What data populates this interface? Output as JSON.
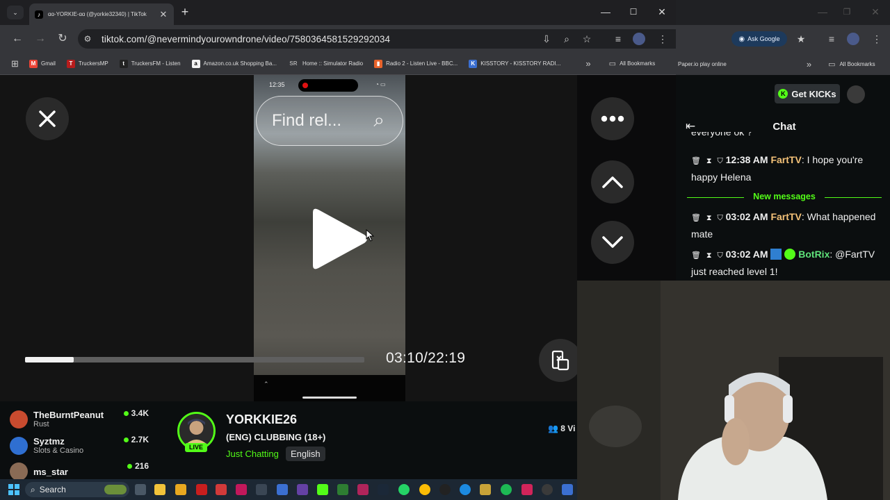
{
  "browser": {
    "tab_title": "ɑɑ-YORKIE-ɑɑ (@yorkie32340) | TikTok",
    "url": "tiktok.com/@nevermindyourowndrone/video/7580364581529292034",
    "new_tab_symbol": "+",
    "bookmarks": [
      {
        "label": "Gmail",
        "color": "#ea4335",
        "glyph": "M"
      },
      {
        "label": "TruckersMP",
        "color": "#b71c1c",
        "glyph": "T"
      },
      {
        "label": "TruckersFM - Listen",
        "color": "#222222",
        "glyph": "t"
      },
      {
        "label": "Amazon.co.uk Shopping Ba...",
        "color": "#f2f2f2",
        "glyph": "a"
      },
      {
        "label": "Home :: Simulator Radio",
        "color": "#555555",
        "glyph": "SR"
      },
      {
        "label": "Radio 2 - Listen Live - BBC...",
        "color": "#e8632b",
        "glyph": "▮"
      },
      {
        "label": "KISSTORY - KISSTORY RADI...",
        "color": "#3b6fd1",
        "glyph": "K"
      }
    ],
    "all_bookmarks": "All Bookmarks"
  },
  "browser2": {
    "ask_google": "Ask Google",
    "bookmark": "Paper.io play online",
    "all_bookmarks": "All Bookmarks"
  },
  "video": {
    "phone_time": "12:35",
    "search_text": "Find rel...",
    "time": "03:10/22:19",
    "progress": 0.143
  },
  "recommended": [
    {
      "name": "TheBurntPeanut",
      "category": "Rust",
      "viewers": "3.4K",
      "color": "#c84b2f"
    },
    {
      "name": "Syztmz",
      "category": "Slots & Casino",
      "viewers": "2.7K",
      "color": "#2f6fd1"
    },
    {
      "name": "ms_star",
      "category": "",
      "viewers": "216",
      "color": "#8a6b55"
    }
  ],
  "stream": {
    "streamer": "YORKKIE26",
    "live": "LIVE",
    "title": "(ENG) CLUBBING (18+)",
    "category": "Just Chatting",
    "language": "English",
    "viewers": "8 Vi"
  },
  "chat": {
    "get_kicks": "Get KICKs",
    "title": "Chat",
    "clipped_top": "everyone ok ?",
    "new_messages": "New messages",
    "messages": [
      {
        "time": "12:38 AM",
        "user": "FartTV",
        "text": "I hope you're happy Helena"
      },
      {
        "time": "03:02 AM",
        "user": "FartTV",
        "text": "What happened mate"
      },
      {
        "time": "03:02 AM",
        "user": "BotRix",
        "text": "@FartTV just reached level 1!"
      }
    ]
  },
  "taskbar": {
    "search_placeholder": "Search"
  }
}
